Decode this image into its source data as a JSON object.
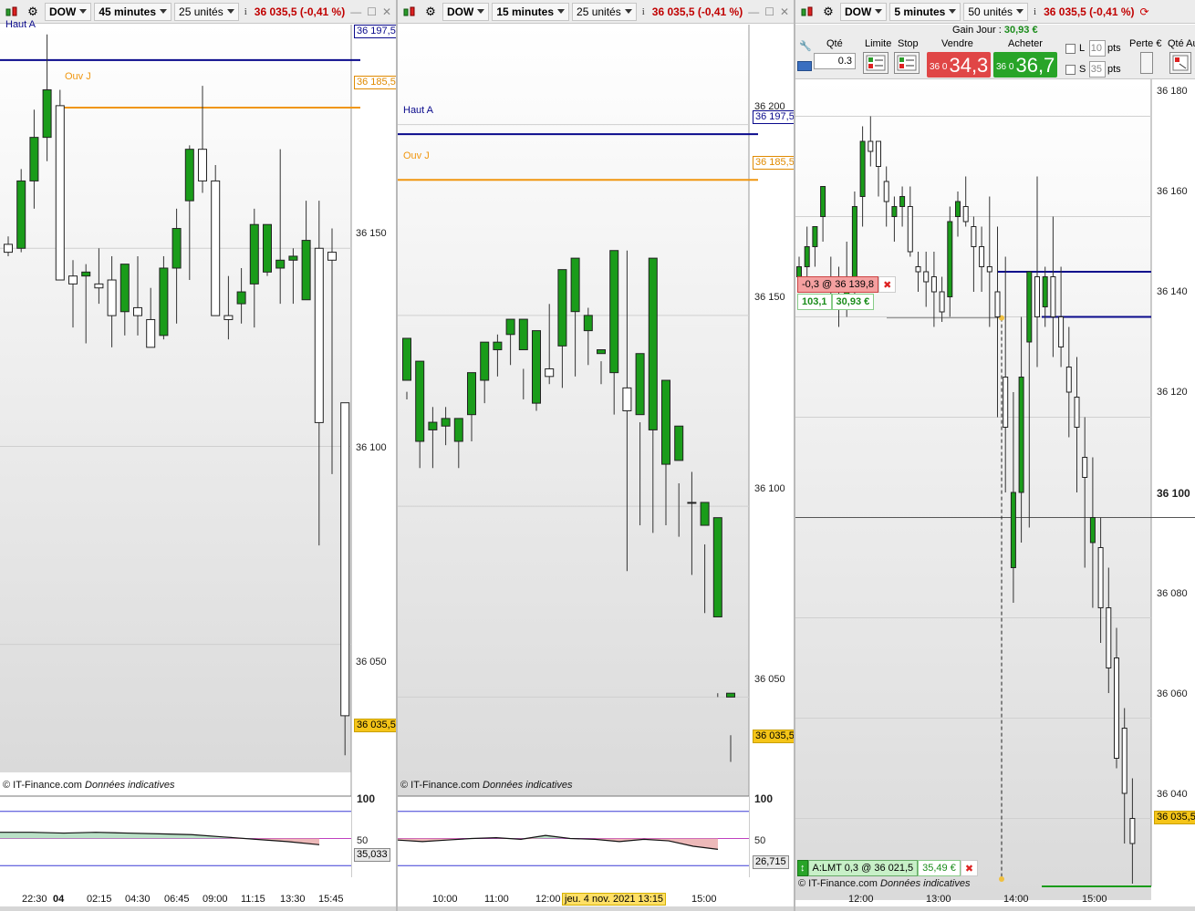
{
  "colors": {
    "up": "#1a9c1a",
    "down": "#ffffff",
    "haut": "#0a0a8c",
    "ouv": "#f0960f",
    "last": "#f5c518",
    "rsi_high": "#3b3bd6",
    "rsi_mid": "#c040c0"
  },
  "panels": [
    {
      "symbol": "DOW",
      "timeframe": "45 minutes",
      "units": "25 unités",
      "quote": "36 035,5 (-0,41 %)",
      "haut_label": "Haut A",
      "ouv_label": "Ouv J",
      "haut_value": "36 197,5",
      "ouv_value": "36 185,5",
      "last_value": "36 035,5",
      "price_ticks": [
        "36 150",
        "36 100",
        "36 050"
      ],
      "credit": "© IT-Finance.com",
      "credit_note": "Données indicatives",
      "rsi_top": "100",
      "rsi_mid": "50",
      "rsi_value": "35,033",
      "time_labels": [
        "22:30",
        "04",
        "02:15",
        "04:30",
        "06:45",
        "09:00",
        "11:15",
        "13:30",
        "15:45"
      ]
    },
    {
      "symbol": "DOW",
      "timeframe": "15 minutes",
      "units": "25 unités",
      "quote": "36 035,5 (-0,41 %)",
      "haut_label": "Haut A",
      "ouv_label": "Ouv J",
      "haut_value": "36 197,5",
      "ouv_value": "36 185,5",
      "last_value": "36 035,5",
      "price_ticks": [
        "36 200",
        "36 150",
        "36 100",
        "36 050"
      ],
      "credit": "© IT-Finance.com",
      "credit_note": "Données indicatives",
      "rsi_top": "100",
      "rsi_mid": "50",
      "rsi_value": "26,715",
      "time_labels": [
        "10:00",
        "11:00",
        "12:00",
        "15:00"
      ],
      "date_flag": "jeu. 4 nov. 2021 13:15"
    },
    {
      "symbol": "DOW",
      "timeframe": "5 minutes",
      "units": "50 unités",
      "quote": "36 035,5 (-0,41 %)",
      "last_value": "36 035,5",
      "price_ticks": [
        "36 180",
        "36 160",
        "36 140",
        "36 120",
        "36 100",
        "36 080",
        "36 060",
        "36 040"
      ],
      "credit": "© IT-Finance.com",
      "credit_note": "Données indicatives",
      "time_labels": [
        "12:00",
        "13:00",
        "14:00",
        "15:00"
      ],
      "trade": {
        "gain_label": "Gain Jour :",
        "gain_value": "30,93 €",
        "qty_label": "Qté",
        "qty_value": "0.3",
        "limit_label": "Limite",
        "stop_label": "Stop",
        "sell_label": "Vendre",
        "buy_label": "Acheter",
        "sell_prefix": "36 0",
        "sell_price": "34,3",
        "buy_prefix": "36 0",
        "buy_price": "36,7",
        "l_label": "L",
        "l_value": "10",
        "s_label": "S",
        "s_value": "35",
        "pts": "pts",
        "perte_label": "Perte €",
        "qte_au_label": "Qté Au"
      },
      "position": {
        "label": "-0,3 @ 36 139,8",
        "pnl_pts": "103,1",
        "pnl_eur": "30,93 €"
      },
      "order": {
        "label": "A:LMT  0,3 @ 36 021,5",
        "value": "35,49 €"
      }
    }
  ],
  "chart_data": [
    {
      "type": "candlestick",
      "title": "DOW 45 minutes",
      "ylim": [
        36020,
        36206
      ],
      "reference_lines": [
        {
          "label": "Haut A",
          "value": 36197.5
        },
        {
          "label": "Ouv J",
          "value": 36185.5
        }
      ],
      "candles": [
        [
          36151,
          36153,
          36148,
          36149
        ],
        [
          36150,
          36170,
          36149,
          36167
        ],
        [
          36167,
          36185,
          36160,
          36178
        ],
        [
          36178,
          36204,
          36172,
          36190
        ],
        [
          36186,
          36190,
          36142,
          36142
        ],
        [
          36143,
          36147,
          36130,
          36141
        ],
        [
          36143,
          36146,
          36126,
          36144
        ],
        [
          36141,
          36150,
          36136,
          36140
        ],
        [
          36142,
          36148,
          36125,
          36133
        ],
        [
          36134,
          36144,
          36128,
          36146
        ],
        [
          36135,
          36148,
          36128,
          36133
        ],
        [
          36132,
          36140,
          36125,
          36125
        ],
        [
          36128,
          36148,
          36127,
          36145
        ],
        [
          36145,
          36160,
          36131,
          36155
        ],
        [
          36162,
          36176,
          36142,
          36175
        ],
        [
          36175,
          36191,
          36164,
          36167
        ],
        [
          36167,
          36171,
          36135,
          36133
        ],
        [
          36133,
          36143,
          36127,
          36132
        ],
        [
          36136,
          36145,
          36131,
          36139
        ],
        [
          36141,
          36160,
          36130,
          36156
        ],
        [
          36144,
          36155,
          36143,
          36156
        ],
        [
          36145,
          36175,
          36136,
          36147
        ],
        [
          36147,
          36150,
          36136,
          36148
        ],
        [
          36137,
          36162,
          36140,
          36152
        ],
        [
          36150,
          36162,
          36075,
          36106
        ],
        [
          36149,
          36155,
          36093,
          36147
        ],
        [
          36111,
          36098,
          36022,
          36032
        ]
      ],
      "rsi": [
        58,
        58,
        57,
        58,
        57,
        56,
        55,
        52,
        49,
        46,
        42
      ]
    },
    {
      "type": "candlestick",
      "title": "DOW 15 minutes",
      "ylim": [
        36025,
        36225
      ],
      "reference_lines": [
        {
          "label": "Haut A",
          "value": 36197.5
        },
        {
          "label": "Ouv J",
          "value": 36185.5
        }
      ],
      "candles": [
        [
          36133,
          36128,
          36130,
          36144
        ],
        [
          36117,
          36117,
          36110,
          36138
        ],
        [
          36120,
          36126,
          36110,
          36122
        ],
        [
          36121,
          36126,
          36116,
          36123
        ],
        [
          36117,
          36119,
          36110,
          36123
        ],
        [
          36124,
          36127,
          36117,
          36135
        ],
        [
          36133,
          36140,
          36127,
          36143
        ],
        [
          36141,
          36145,
          36134,
          36143
        ],
        [
          36145,
          36145,
          36137,
          36149
        ],
        [
          36141,
          36136,
          36128,
          36149
        ],
        [
          36127,
          36140,
          36125,
          36146
        ],
        [
          36136,
          36153,
          36132,
          36134
        ],
        [
          36142,
          36155,
          36131,
          36162
        ],
        [
          36151,
          36159,
          36134,
          36165
        ],
        [
          36146,
          36152,
          36137,
          36150
        ],
        [
          36140,
          36138,
          36132,
          36141
        ],
        [
          36135,
          36162,
          36124,
          36167
        ],
        [
          36131,
          36167,
          36083,
          36125
        ],
        [
          36124,
          36122,
          36095,
          36140
        ],
        [
          36120,
          36135,
          36093,
          36165
        ],
        [
          36111,
          36127,
          36095,
          36133
        ],
        [
          36112,
          36106,
          36092,
          36121
        ],
        [
          36101,
          36109,
          36082,
          36101
        ],
        [
          36095,
          36090,
          36072,
          36101
        ],
        [
          36071,
          36051,
          36050,
          36097
        ],
        [
          36050,
          36040,
          36033,
          36051
        ]
      ],
      "rsi": [
        48,
        46,
        48,
        50,
        51,
        49,
        54,
        50,
        49,
        46,
        49,
        47,
        40,
        36
      ]
    },
    {
      "type": "candlestick",
      "title": "DOW 5 minutes",
      "ylim": [
        36025,
        36185
      ],
      "reference_lines": [
        {
          "label": "position",
          "value": 36139.8
        },
        {
          "label": "order",
          "value": 36021.5
        }
      ]
    }
  ]
}
